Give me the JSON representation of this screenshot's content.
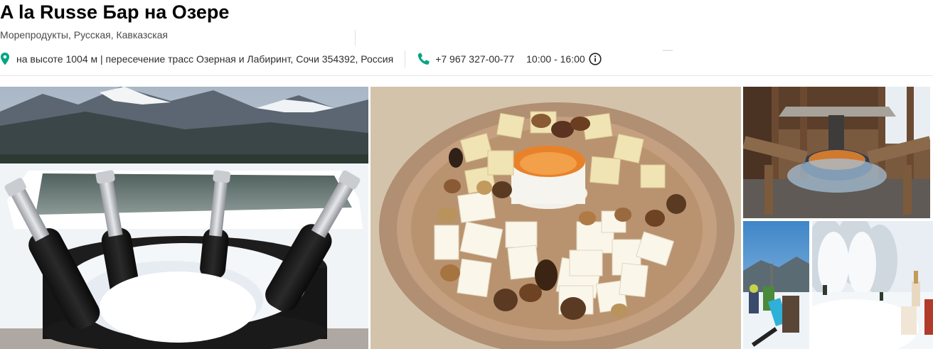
{
  "restaurant": {
    "name": "A la Russe Бар на Озере",
    "cuisines": "Морепродукты, Русская, Кавказская",
    "address": "на высоте 1004 м | пересечение трасс Озерная и Лабиринт, Сочи 354392, Россия",
    "phone": "+7 967 327-00-77",
    "hours": "10:00 - 16:00"
  },
  "icons": {
    "location": "map-pin-icon",
    "phone": "phone-icon",
    "hours_info": "info-icon"
  },
  "colors": {
    "accent": "#00a680",
    "text": "#000000",
    "muted": "#4a4a4a"
  },
  "photos": [
    {
      "name": "champagne-on-ice-photo"
    },
    {
      "name": "cheese-plate-photo"
    },
    {
      "name": "fire-pit-terrace-photo"
    },
    {
      "name": "snowboarders-photo"
    },
    {
      "name": "snowy-forest-photo"
    }
  ]
}
